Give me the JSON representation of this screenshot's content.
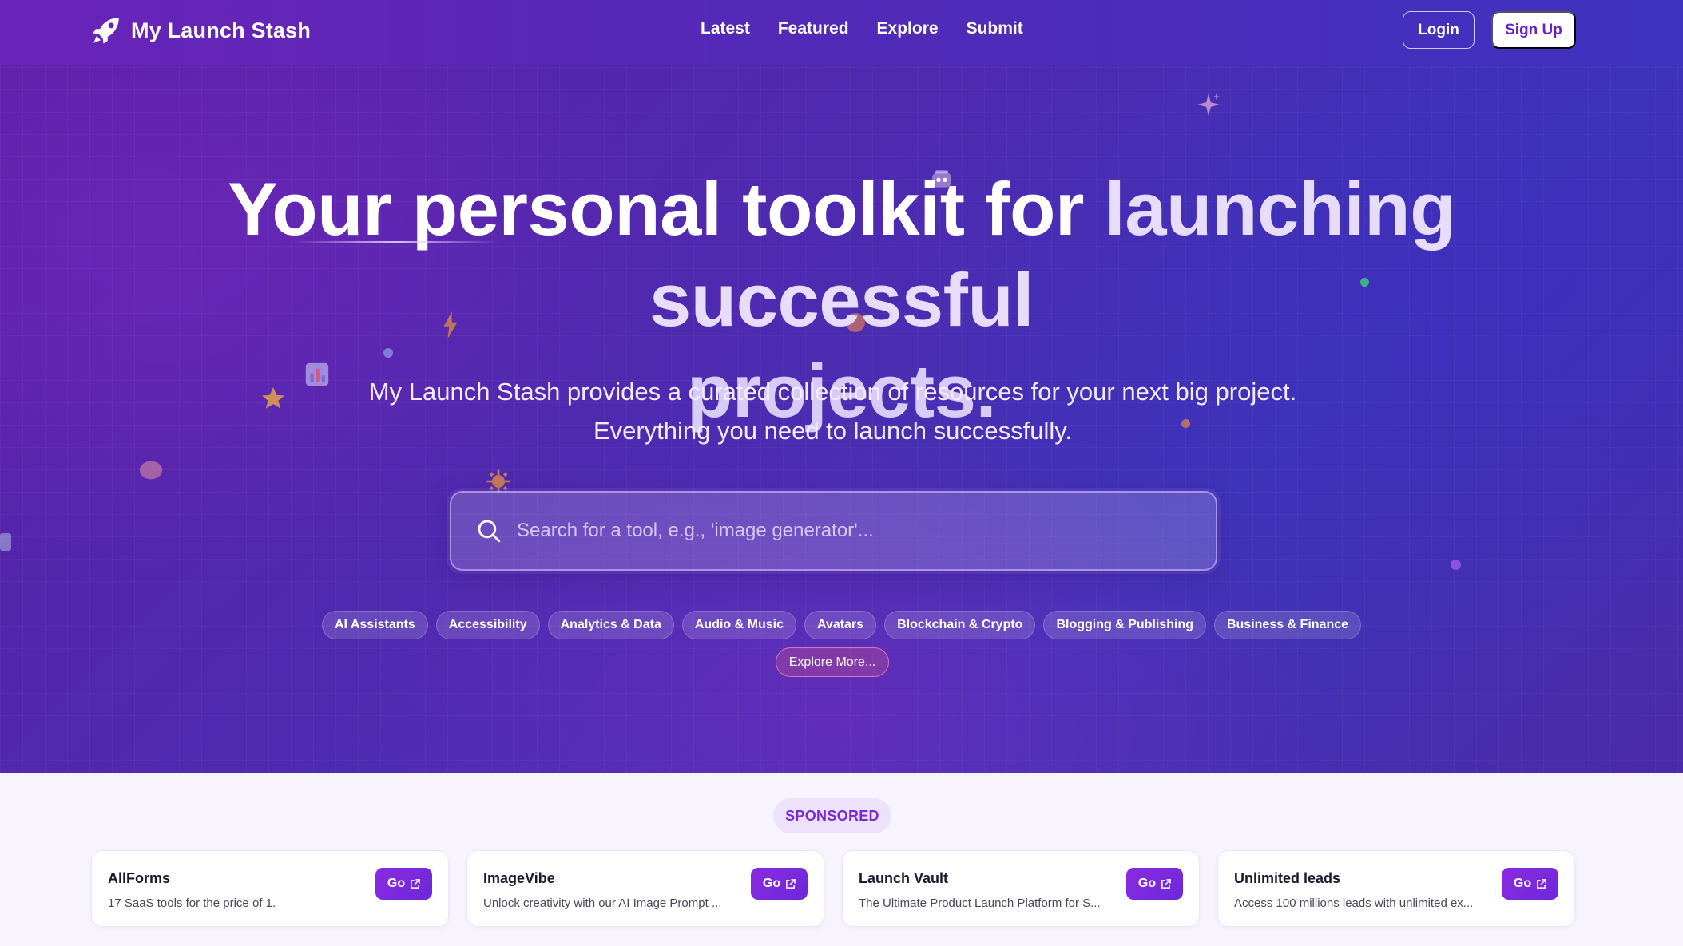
{
  "nav": {
    "brand_name": "My Launch Stash",
    "links": [
      "Latest",
      "Featured",
      "Explore",
      "Submit"
    ],
    "login_label": "Login",
    "signup_label": "Sign Up"
  },
  "hero": {
    "headline_line1_a": "Your ",
    "headline_line1_b": "personal toolkit for ",
    "headline_line1_c": "launching successful",
    "headline_line2": "projects.",
    "subtext": "My Launch Stash provides a curated collection of resources for your next big project. Everything you need to launch successfully.",
    "search_placeholder": "Search for a tool, e.g., 'image generator'...",
    "categories": [
      "AI Assistants",
      "Accessibility",
      "Analytics & Data",
      "Audio & Music",
      "Avatars",
      "Blockchain & Crypto",
      "Blogging & Publishing",
      "Business & Finance"
    ],
    "explore_more_label": "Explore More..."
  },
  "sponsored": {
    "badge": "SPONSORED",
    "go_label": "Go",
    "cards": [
      {
        "title": "AllForms",
        "desc": "17 SaaS tools for the price of 1."
      },
      {
        "title": "ImageVibe",
        "desc": "Unlock creativity with our AI Image Prompt ..."
      },
      {
        "title": "Launch Vault",
        "desc": "The Ultimate Product Launch Platform for S..."
      },
      {
        "title": "Unlimited leads",
        "desc": "Access 100 millions leads with unlimited ex..."
      }
    ]
  },
  "colors": {
    "brand_purple": "#6a22c4",
    "go_button": "#7c2ae0",
    "hero_start": "#5b1fa8",
    "hero_end": "#3f34b8"
  },
  "icons": {
    "brand": "rocket-icon",
    "search": "search-icon",
    "external": "external-link-icon"
  }
}
